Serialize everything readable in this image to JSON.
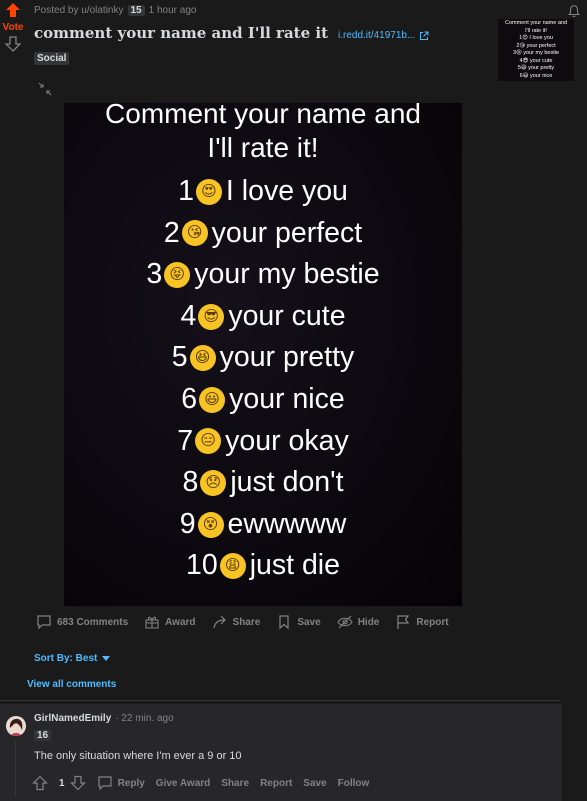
{
  "vote": {
    "label": "Vote"
  },
  "post": {
    "posted_by": "Posted by u/olatinky",
    "author_flair": "15",
    "time": "1 hour ago",
    "title": "comment your name and I'll rate it",
    "domain": "i.redd.it/41971b...",
    "flair": "Social"
  },
  "thumbnail_lines": [
    "Comment your name and",
    "I'll rate it!",
    "1😍 I love you",
    "2😘 your perfect",
    "3😝 your my bestie",
    "4😎 your cute",
    "5😆 your pretty",
    "6😃 your nice"
  ],
  "image": {
    "title_line1": "Comment your name and",
    "title_line2": "I'll rate it!",
    "rows": [
      {
        "num": "1",
        "emoji": "😍",
        "text": "I love you"
      },
      {
        "num": "2",
        "emoji": "😘",
        "text": "your perfect"
      },
      {
        "num": "3",
        "emoji": "😝",
        "text": "your my bestie"
      },
      {
        "num": "4",
        "emoji": "😎",
        "text": "your cute"
      },
      {
        "num": "5",
        "emoji": "😆",
        "text": "your pretty"
      },
      {
        "num": "6",
        "emoji": "😃",
        "text": "your nice"
      },
      {
        "num": "7",
        "emoji": "😑",
        "text": "your okay"
      },
      {
        "num": "8",
        "emoji": "😞",
        "text": "just don't"
      },
      {
        "num": "9",
        "emoji": "😵",
        "text": "ewwwww"
      },
      {
        "num": "10",
        "emoji": "😩",
        "text": "just die"
      }
    ]
  },
  "actions": {
    "comments": "683 Comments",
    "award": "Award",
    "share": "Share",
    "save": "Save",
    "hide": "Hide",
    "report": "Report"
  },
  "sort": {
    "label": "Sort By: Best"
  },
  "view_all": "View all comments",
  "comment": {
    "author": "GirlNamedEmily",
    "time": "· 22 min. ago",
    "flair": "16",
    "body": "The only situation where I'm ever a 9 or 10",
    "score": "1",
    "reply": "Reply",
    "give_award": "Give Award",
    "share": "Share",
    "report": "Report",
    "save": "Save",
    "follow": "Follow"
  },
  "colors": {
    "accent_orange": "#ff4500",
    "link_blue": "#4fbcff",
    "bg": "#1a1a1b"
  }
}
